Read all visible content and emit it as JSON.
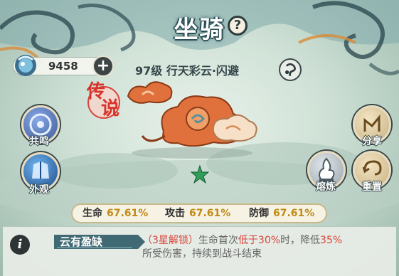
{
  "header": {
    "title": "坐骑",
    "help_symbol": "?"
  },
  "currency": {
    "value": "9458",
    "plus_symbol": "+"
  },
  "mount": {
    "name": "97级  行天彩云·闪避",
    "rarity_char_1": "传",
    "rarity_char_2": "说"
  },
  "left_buttons": [
    {
      "label": "共鸣"
    },
    {
      "label": "外观"
    }
  ],
  "right_buttons": [
    {
      "label": "分享"
    },
    {
      "label": "熔炼"
    },
    {
      "label": "重置"
    }
  ],
  "stats": [
    {
      "label": "生命",
      "value": "67.61%"
    },
    {
      "label": "攻击",
      "value": "67.61%"
    },
    {
      "label": "防御",
      "value": "67.61%"
    }
  ],
  "skill": {
    "info_symbol": "i",
    "name": "云有盈缺",
    "unlock": "（3星解锁）",
    "desc_a": "生命首次",
    "desc_b": "低于30%",
    "desc_c": "时，降低",
    "desc_d": "35%",
    "desc_line2": "所受伤害，持续到战斗结束"
  },
  "colors": {
    "stat_value": "#c18a14",
    "highlight_red": "#d9443a",
    "title_outline": "#2a4f56"
  }
}
